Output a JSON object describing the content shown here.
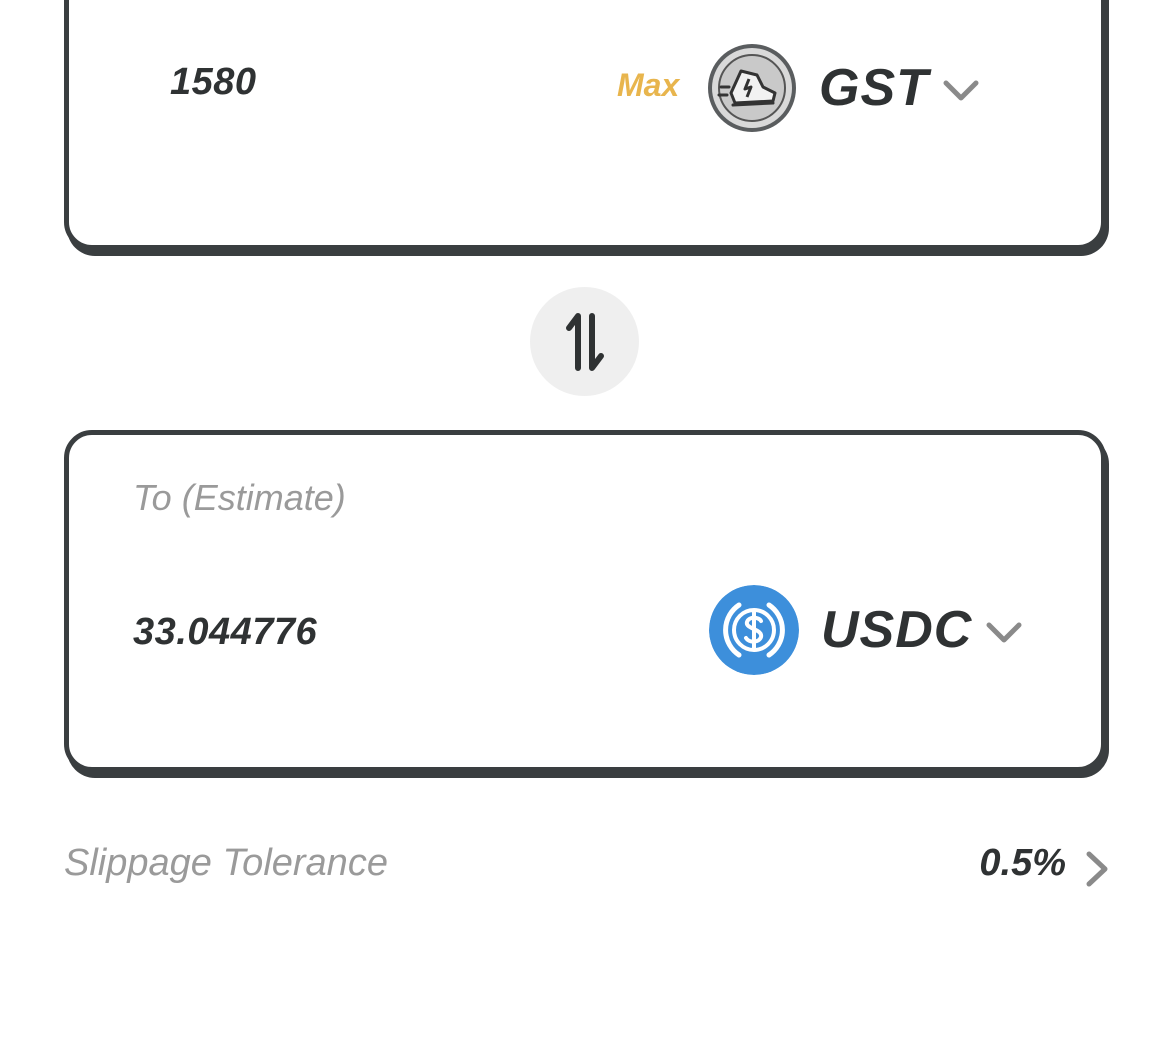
{
  "from": {
    "amount": "1580",
    "max_label": "Max",
    "token": {
      "symbol": "GST",
      "icon": "gst-sneaker-icon"
    }
  },
  "swap": {
    "icon": "swap-arrows-icon"
  },
  "to": {
    "label": "To (Estimate)",
    "amount": "33.044776",
    "token": {
      "symbol": "USDC",
      "icon": "usdc-icon"
    }
  },
  "slippage": {
    "label": "Slippage Tolerance",
    "value": "0.5%"
  },
  "colors": {
    "text_dark": "#2f3233",
    "text_muted": "#9a9a9a",
    "accent_max": "#e8b54d",
    "border": "#3a3e40",
    "usdc_blue": "#3d8fdb",
    "swap_bg": "#efefef"
  }
}
